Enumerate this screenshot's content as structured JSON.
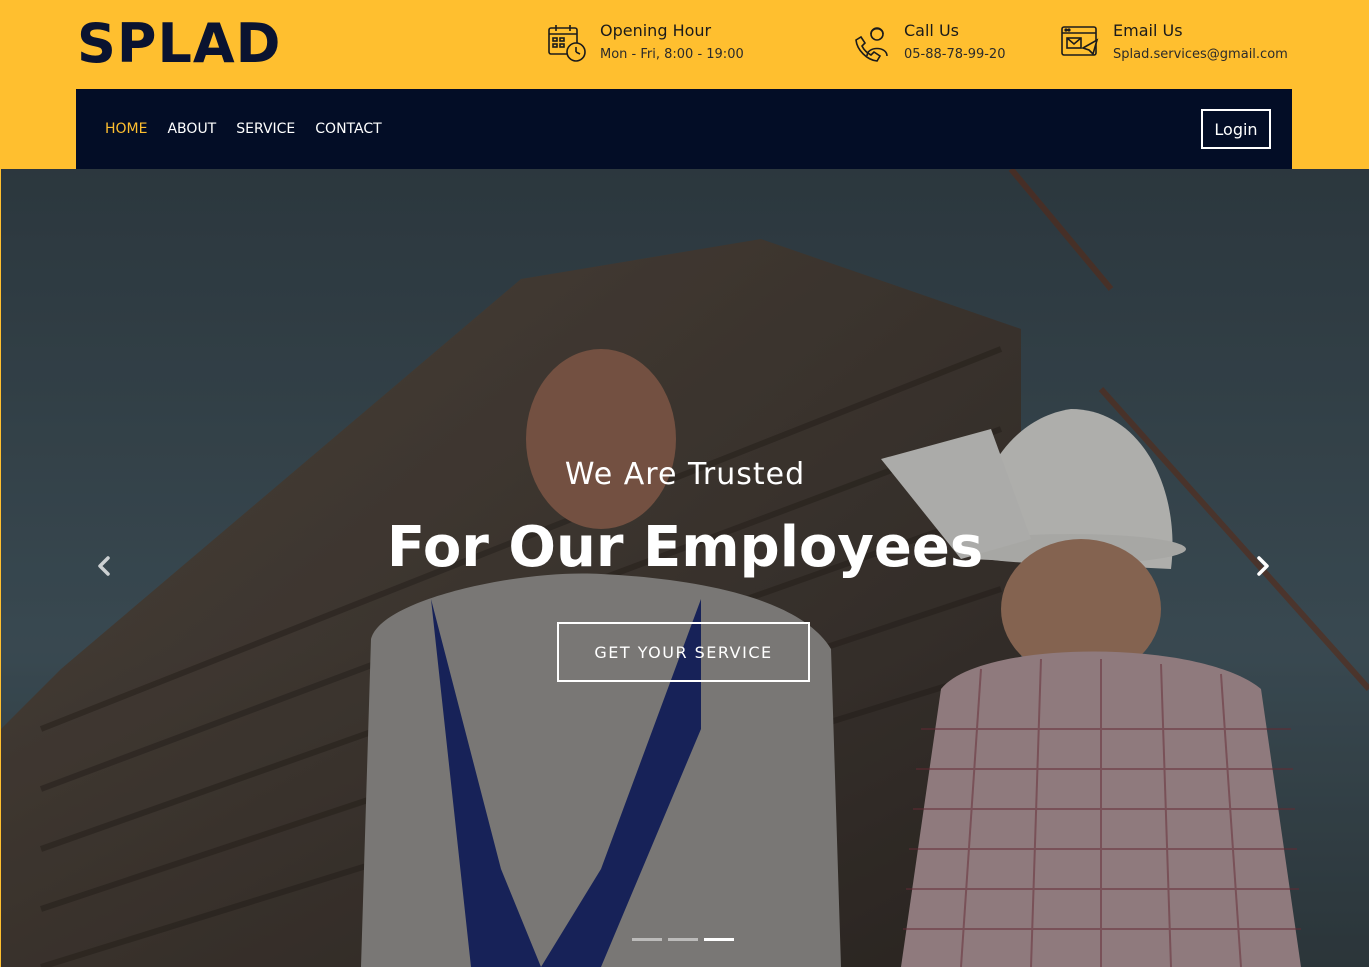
{
  "brand": {
    "name": "SPLAD"
  },
  "header": {
    "hours": {
      "title": "Opening Hour",
      "value": "Mon - Fri, 8:00 - 19:00",
      "icon": "calendar-clock-icon"
    },
    "call": {
      "title": "Call Us",
      "value": "05-88-78-99-20",
      "icon": "phone-support-icon"
    },
    "email": {
      "title": "Email Us",
      "value": "Splad.services@gmail.com",
      "icon": "email-icon"
    }
  },
  "nav": {
    "items": [
      {
        "label": "HOME",
        "active": true
      },
      {
        "label": "ABOUT",
        "active": false
      },
      {
        "label": "SERVICE",
        "active": false
      },
      {
        "label": "CONTACT",
        "active": false
      }
    ],
    "login": "Login"
  },
  "hero": {
    "subtitle": "We Are Trusted",
    "title": "For Our Employees",
    "cta": "GET YOUR SERVICE",
    "slides": {
      "count": 3,
      "active_index": 2
    }
  },
  "colors": {
    "accent": "#ffbf2f",
    "navbar": "#030d26",
    "logo": "#0a1330"
  }
}
